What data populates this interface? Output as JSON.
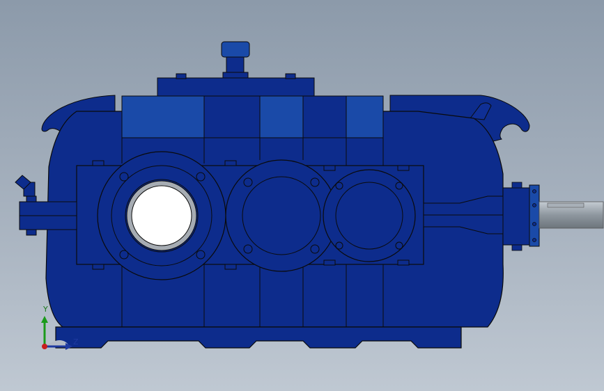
{
  "viewport": {
    "background_top": "#8c9aaa",
    "background_bottom": "#bfc8d2"
  },
  "model": {
    "component": "gearbox-reducer",
    "body_color": "#0d2c8c",
    "edge_color": "#0a0a0a",
    "highlight_color": "#1a4aa8",
    "shaft_color": "#8a939c"
  },
  "triad": {
    "y_label": "Y",
    "z_label": "Z",
    "y_color": "#1a9a1a",
    "z_color": "#1f3aa0",
    "x_color": "#c81e1e"
  }
}
